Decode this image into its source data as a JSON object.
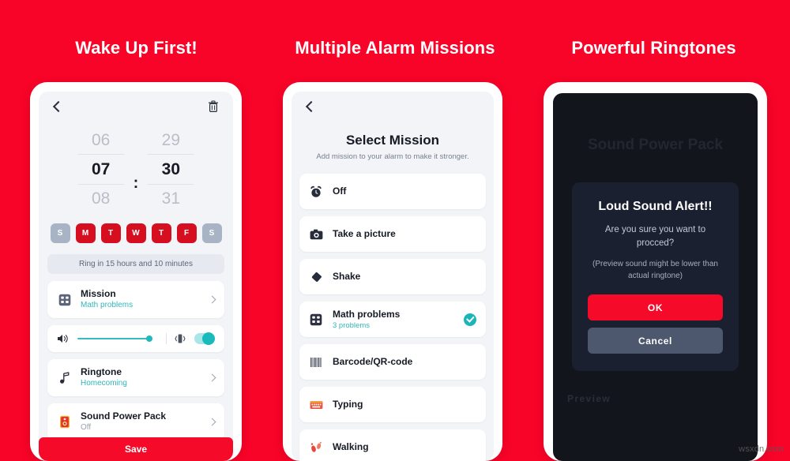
{
  "background_color": "#F80428",
  "accent_red": "#F50A29",
  "accent_teal": "#2FB7B8",
  "panels": [
    {
      "headline": "Wake Up First!"
    },
    {
      "headline": "Multiple Alarm Missions"
    },
    {
      "headline": "Powerful Ringtones"
    }
  ],
  "phone1": {
    "back_icon": "chevron-left-icon",
    "delete_icon": "trash-icon",
    "time_picker": {
      "hour_prev": "06",
      "hour_selected": "07",
      "hour_next": "08",
      "separator": ":",
      "minute_prev": "29",
      "minute_selected": "30",
      "minute_next": "31"
    },
    "days": [
      {
        "label": "S",
        "active": false
      },
      {
        "label": "M",
        "active": true
      },
      {
        "label": "T",
        "active": true
      },
      {
        "label": "W",
        "active": true
      },
      {
        "label": "T",
        "active": true
      },
      {
        "label": "F",
        "active": true
      },
      {
        "label": "S",
        "active": false
      }
    ],
    "ring_info": "Ring in 15 hours and 10 minutes",
    "mission": {
      "title": "Mission",
      "subtitle": "Math problems",
      "icon": "grid-mission-icon"
    },
    "volume": {
      "speaker_icon": "speaker-icon",
      "level_percent": 93,
      "vibration_icon": "vibration-icon",
      "vibration_on": true
    },
    "ringtone": {
      "title": "Ringtone",
      "subtitle": "Homecoming",
      "icon": "music-note-icon"
    },
    "sound_power_pack": {
      "title": "Sound Power Pack",
      "subtitle": "Off",
      "icon": "speaker-box-icon"
    },
    "save_label": "Save"
  },
  "phone2": {
    "back_icon": "chevron-left-icon",
    "title": "Select Mission",
    "subtitle": "Add mission to your alarm to make it stronger.",
    "missions": [
      {
        "label": "Off",
        "note": "",
        "icon": "alarm-clock-icon",
        "selected": false
      },
      {
        "label": "Take a picture",
        "note": "",
        "icon": "camera-icon",
        "selected": false
      },
      {
        "label": "Shake",
        "note": "",
        "icon": "shake-diamond-icon",
        "selected": false
      },
      {
        "label": "Math problems",
        "note": "3 problems",
        "icon": "grid-mission-icon",
        "selected": true
      },
      {
        "label": "Barcode/QR-code",
        "note": "",
        "icon": "barcode-icon",
        "selected": false
      },
      {
        "label": "Typing",
        "note": "",
        "icon": "keyboard-icon",
        "selected": false
      },
      {
        "label": "Walking",
        "note": "",
        "icon": "footprints-icon",
        "selected": false
      }
    ]
  },
  "phone3": {
    "screen_title": "Sound Power Pack",
    "dialog": {
      "title": "Loud Sound Alert!!",
      "message": "Are you sure you want to procced?",
      "note": "(Preview sound might be lower than actual ringtone)",
      "ok_label": "OK",
      "cancel_label": "Cancel"
    },
    "preview_label": "Preview"
  },
  "watermark": "wsxdn.com"
}
